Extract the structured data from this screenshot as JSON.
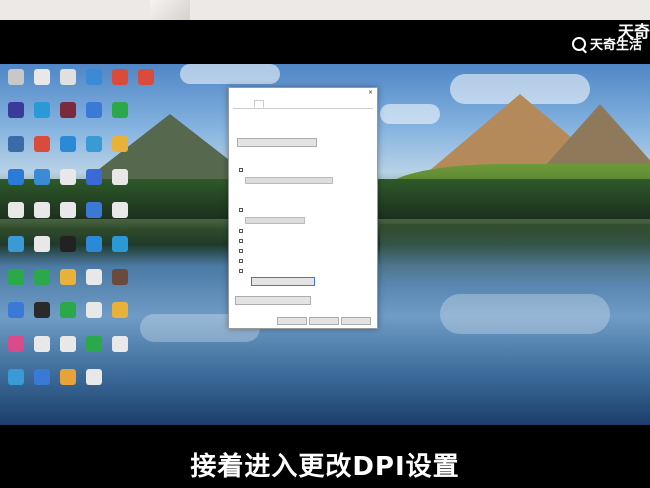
{
  "watermark": {
    "brand": "天奇生活",
    "corner": "天奇"
  },
  "subtitle": "接着进入更改DPI设置",
  "desktop_icons": [
    {
      "name": "icon-01",
      "color": "#c8c8c8"
    },
    {
      "name": "icon-02",
      "color": "#e8e8e8"
    },
    {
      "name": "icon-03",
      "color": "#e0e0e0"
    },
    {
      "name": "icon-04",
      "color": "#3a8ad6"
    },
    {
      "name": "icon-05",
      "color": "#d94b3a"
    },
    {
      "name": "icon-06",
      "color": "#d94b3a"
    },
    {
      "name": "icon-07",
      "color": "#3a3a9a"
    },
    {
      "name": "icon-08",
      "color": "#2a9ad6"
    },
    {
      "name": "icon-09",
      "color": "#7a2a3a"
    },
    {
      "name": "icon-10",
      "color": "#3a7ad6"
    },
    {
      "name": "icon-11",
      "color": "#2aa84a"
    },
    {
      "name": "icon-12",
      "color": "#3a6aa8"
    },
    {
      "name": "icon-13",
      "color": "#d94b3a"
    },
    {
      "name": "icon-14",
      "color": "#2a8ad6"
    },
    {
      "name": "icon-15",
      "color": "#3a9ad6"
    },
    {
      "name": "icon-16",
      "color": "#e8b23a"
    },
    {
      "name": "icon-17",
      "color": "#2a7ad6"
    },
    {
      "name": "icon-18",
      "color": "#3a8ad6"
    },
    {
      "name": "icon-19",
      "color": "#e8e8e8"
    },
    {
      "name": "icon-20",
      "color": "#3a6ad6"
    },
    {
      "name": "icon-21",
      "color": "#e8e8e8"
    },
    {
      "name": "icon-22",
      "color": "#e8e8e8"
    },
    {
      "name": "icon-23",
      "color": "#e8e8e8"
    },
    {
      "name": "icon-24",
      "color": "#e8e8e8"
    },
    {
      "name": "icon-25",
      "color": "#3a7ad6"
    },
    {
      "name": "icon-26",
      "color": "#e8e8e8"
    },
    {
      "name": "icon-27",
      "color": "#3a9ad6"
    },
    {
      "name": "icon-28",
      "color": "#e8e8e8"
    },
    {
      "name": "icon-29",
      "color": "#222222"
    },
    {
      "name": "icon-30",
      "color": "#2a8ad6"
    },
    {
      "name": "icon-31",
      "color": "#2a9ad6"
    },
    {
      "name": "icon-32",
      "color": "#2aa84a"
    },
    {
      "name": "icon-33",
      "color": "#2aa84a"
    },
    {
      "name": "icon-34",
      "color": "#e8b23a"
    },
    {
      "name": "icon-35",
      "color": "#e8e8e8"
    },
    {
      "name": "icon-36",
      "color": "#6a4a3a"
    },
    {
      "name": "icon-37",
      "color": "#3a7ad6"
    },
    {
      "name": "icon-38",
      "color": "#2a2a2a"
    },
    {
      "name": "icon-39",
      "color": "#2aa84a"
    },
    {
      "name": "icon-40",
      "color": "#e8e8e8"
    },
    {
      "name": "icon-41",
      "color": "#e8b23a"
    },
    {
      "name": "icon-42",
      "color": "#d94b8a"
    },
    {
      "name": "icon-43",
      "color": "#e8e8e8"
    },
    {
      "name": "icon-44",
      "color": "#e8e8e8"
    },
    {
      "name": "icon-45",
      "color": "#2aa84a"
    },
    {
      "name": "icon-46",
      "color": "#e8e8e8"
    },
    {
      "name": "icon-47",
      "color": "#3a9ad6"
    },
    {
      "name": "icon-48",
      "color": "#3a7ad6"
    },
    {
      "name": "icon-49",
      "color": "#e8a23a"
    },
    {
      "name": "icon-50",
      "color": "#e8e8e8"
    }
  ]
}
